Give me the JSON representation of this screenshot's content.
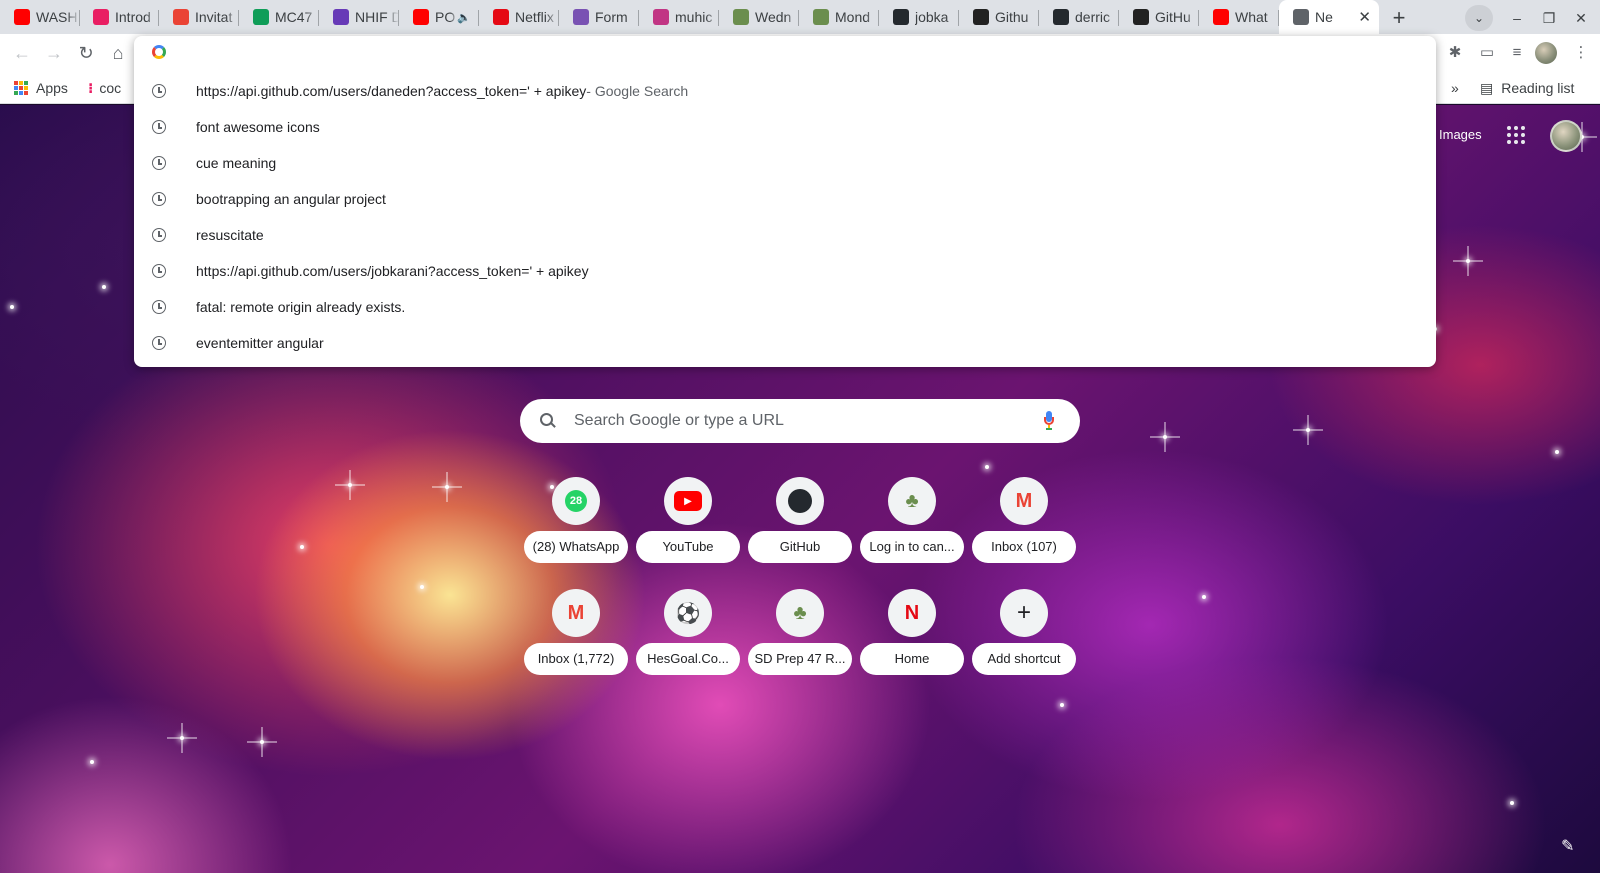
{
  "tabs": [
    {
      "title": "WASH",
      "favicon": "youtube-icon",
      "color": "#ff0000"
    },
    {
      "title": "Introd",
      "favicon": "recording-icon",
      "color": "#e91e63"
    },
    {
      "title": "Invitat",
      "favicon": "gmail-icon",
      "color": "#ea4335"
    },
    {
      "title": "MC47",
      "favicon": "sheets-plus-icon",
      "color": "#0f9d58"
    },
    {
      "title": "NHIF D",
      "favicon": "forms-icon",
      "color": "#673ab7"
    },
    {
      "title": "PO",
      "favicon": "youtube-icon",
      "color": "#ff0000",
      "audio": true
    },
    {
      "title": "Netflix",
      "favicon": "netflix-icon",
      "color": "#e50914"
    },
    {
      "title": "Form",
      "favicon": "bootstrap-icon",
      "color": "#7952b3"
    },
    {
      "title": "muhic",
      "favicon": "instagram-icon",
      "color": "#c13584"
    },
    {
      "title": "Wedn",
      "favicon": "tree-icon",
      "color": "#6b8e4e"
    },
    {
      "title": "Mond",
      "favicon": "tree-icon",
      "color": "#6b8e4e"
    },
    {
      "title": "jobka",
      "favicon": "github-icon",
      "color": "#24292e"
    },
    {
      "title": "Githu",
      "favicon": "angular-icon",
      "color": "#222222"
    },
    {
      "title": "derric",
      "favicon": "github-icon",
      "color": "#24292e"
    },
    {
      "title": "GitHu",
      "favicon": "angular-icon",
      "color": "#222222"
    },
    {
      "title": "What",
      "favicon": "youtube-icon",
      "color": "#ff0000"
    },
    {
      "title": "Ne",
      "favicon": "chrome-icon",
      "color": "#5f6368",
      "active": true
    }
  ],
  "bookmarks": {
    "apps_label": "Apps",
    "item2": "coc",
    "overflow": "»",
    "reading_list": "Reading list"
  },
  "omnibox": {
    "value": "",
    "suggestions": [
      {
        "text": "https://api.github.com/users/daneden?access_token=' + apikey",
        "suffix": " - Google Search"
      },
      {
        "text": "font awesome icons",
        "suffix": ""
      },
      {
        "text": "cue meaning",
        "suffix": ""
      },
      {
        "text": "bootrapping an angular project",
        "suffix": ""
      },
      {
        "text": "resuscitate",
        "suffix": ""
      },
      {
        "text": "https://api.github.com/users/jobkarani?access_token=' + apikey",
        "suffix": ""
      },
      {
        "text": "fatal: remote origin already exists.",
        "suffix": ""
      },
      {
        "text": "eventemitter angular",
        "suffix": ""
      }
    ]
  },
  "ntp": {
    "images_link": "Images",
    "search_placeholder": "Search Google or type a URL",
    "shortcuts": [
      {
        "label": "(28) WhatsApp",
        "icon": "whatsapp-icon",
        "color": "#25d366",
        "badge": "28"
      },
      {
        "label": "YouTube",
        "icon": "youtube-icon",
        "color": "#ff0000"
      },
      {
        "label": "GitHub",
        "icon": "github-icon",
        "color": "#24292e"
      },
      {
        "label": "Log in to can...",
        "icon": "tree-icon",
        "color": "#6b8e4e"
      },
      {
        "label": "Inbox (107)",
        "icon": "gmail-icon",
        "color": "#ea4335"
      },
      {
        "label": "Inbox (1,772)",
        "icon": "gmail-icon",
        "color": "#ea4335"
      },
      {
        "label": "HesGoal.Co...",
        "icon": "soccer-ball-icon",
        "color": "#333333"
      },
      {
        "label": "SD Prep 47 R...",
        "icon": "tree-icon",
        "color": "#6b8e4e"
      },
      {
        "label": "Home",
        "icon": "netflix-icon",
        "color": "#e50914"
      },
      {
        "label": "Add shortcut",
        "icon": "plus-icon",
        "color": "#202124"
      }
    ]
  }
}
